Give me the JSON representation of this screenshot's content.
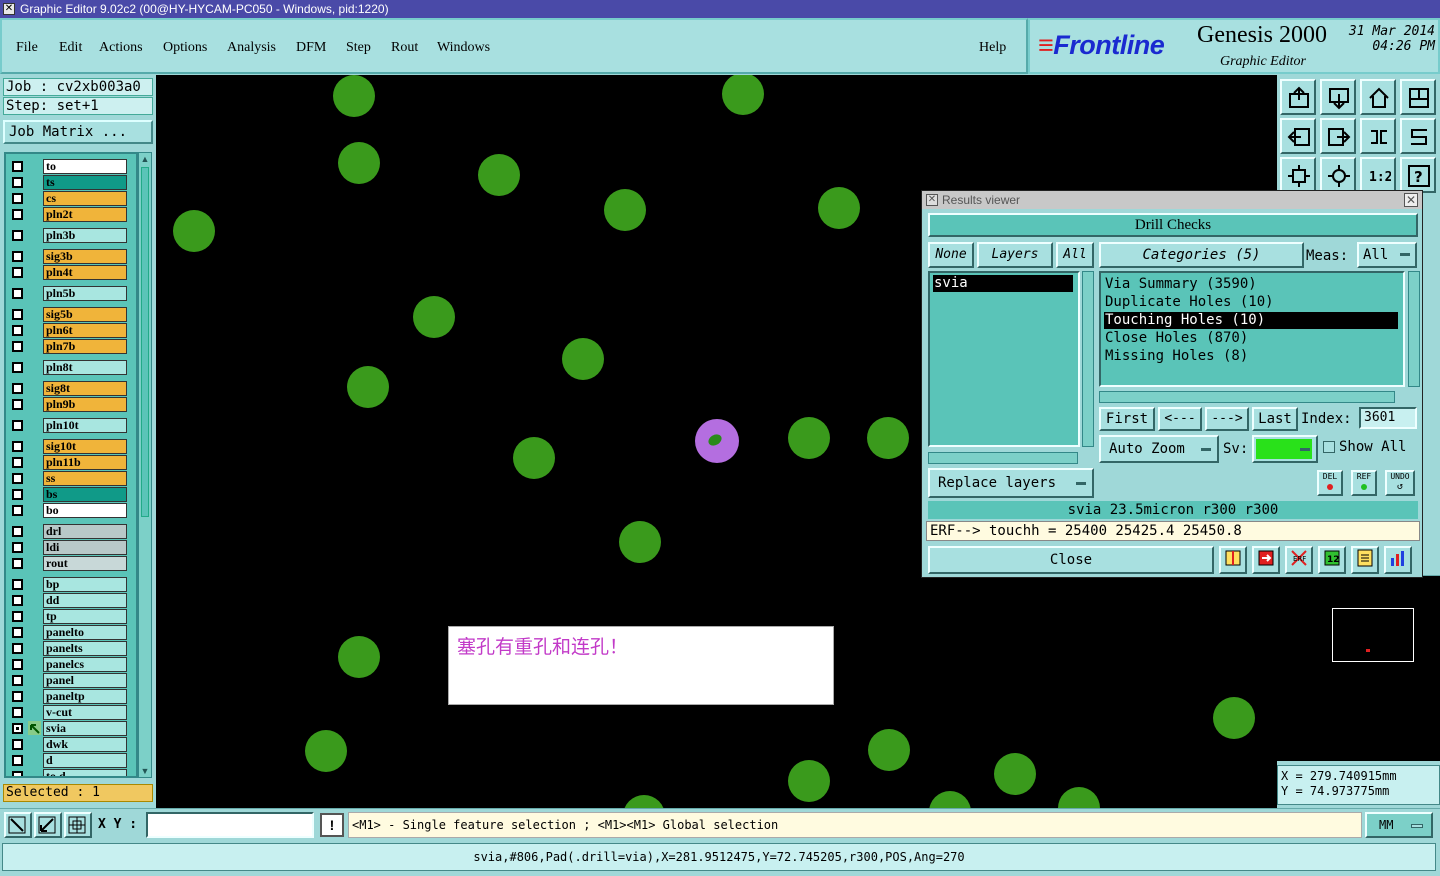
{
  "window": {
    "title": "Graphic Editor 9.02c2 (00@HY-HYCAM-PC050 - Windows, pid:1220)"
  },
  "menu": {
    "items": [
      "File",
      "Edit",
      "Actions",
      "Options",
      "Analysis",
      "DFM",
      "Step",
      "Rout",
      "Windows"
    ],
    "help": "Help"
  },
  "brand": {
    "logo": "Frontline",
    "product": "Genesis 2000",
    "subtitle": "Graphic Editor",
    "date": "31 Mar 2014",
    "time": "04:26 PM"
  },
  "job": {
    "job_line": "Job : cv2xb003a0",
    "step_line": "Step: set+1",
    "matrix_button": "Job Matrix ..."
  },
  "layers": [
    {
      "name": "to",
      "color": "white"
    },
    {
      "name": "ts",
      "color": "teal"
    },
    {
      "name": "cs",
      "color": "orange"
    },
    {
      "name": "pln2t",
      "color": "orange"
    },
    {
      "name": "pln3b",
      "color": "lt"
    },
    {
      "name": "sig3b",
      "color": "orange"
    },
    {
      "name": "pln4t",
      "color": "orange"
    },
    {
      "name": "pln5b",
      "color": "lt"
    },
    {
      "name": "sig5b",
      "color": "orange"
    },
    {
      "name": "pln6t",
      "color": "orange"
    },
    {
      "name": "pln7b",
      "color": "orange"
    },
    {
      "name": "pln8t",
      "color": "lt"
    },
    {
      "name": "sig8t",
      "color": "orange"
    },
    {
      "name": "pln9b",
      "color": "orange"
    },
    {
      "name": "pln10t",
      "color": "lt"
    },
    {
      "name": "sig10t",
      "color": "orange"
    },
    {
      "name": "pln11b",
      "color": "orange"
    },
    {
      "name": "ss",
      "color": "orange"
    },
    {
      "name": "bs",
      "color": "teal"
    },
    {
      "name": "bo",
      "color": "white"
    },
    {
      "name": "drl",
      "color": "grey"
    },
    {
      "name": "ldi",
      "color": "grey"
    },
    {
      "name": "rout",
      "color": "grey2"
    },
    {
      "name": "bp",
      "color": "lt"
    },
    {
      "name": "dd",
      "color": "lt"
    },
    {
      "name": "tp",
      "color": "lt"
    },
    {
      "name": "panelto",
      "color": "lt"
    },
    {
      "name": "panelts",
      "color": "lt"
    },
    {
      "name": "panelcs",
      "color": "lt"
    },
    {
      "name": "panel",
      "color": "lt"
    },
    {
      "name": "paneltp",
      "color": "lt"
    },
    {
      "name": "v-cut",
      "color": "lt"
    },
    {
      "name": "svia",
      "color": "lt"
    },
    {
      "name": "dwk",
      "color": "lt"
    },
    {
      "name": "d",
      "color": "lt"
    },
    {
      "name": "to.d",
      "color": "lt"
    }
  ],
  "selected": "Selected : 1",
  "note": "塞孔有重孔和连孔！",
  "results_viewer": {
    "title": "Results viewer",
    "header": "Drill Checks",
    "none_btn": "None",
    "layers_btn": "Layers",
    "all_btn": "All",
    "layer_items": [
      "svia"
    ],
    "categories_btn": "Categories (5)",
    "meas_label": "Meas:",
    "meas_value": "All",
    "categories": [
      "Via Summary (3590)",
      "Duplicate Holes (10)",
      "Touching Holes (10)",
      "Close Holes (870)",
      "Missing Holes (8)"
    ],
    "first_btn": "First",
    "prev_btn": "<---",
    "next_btn": "--->",
    "last_btn": "Last",
    "index_label": "Index:",
    "index_value": "3601",
    "autozoom_btn": "Auto Zoom",
    "sv_label": "Sv:",
    "showall_label": "Show All",
    "replace_btn": "Replace layers",
    "del_label": "DEL",
    "ref_label": "REF",
    "undo_label": "UNDO",
    "info_line": "svia 23.5micron  r300  r300",
    "erf_line": "ERF--> touchh = 25400 25425.4 25450.8",
    "close_btn": "Close",
    "colors": {
      "sv_green": "#29e11a"
    }
  },
  "coords": {
    "x": "X = 279.740915mm",
    "y": "Y = 74.973775mm"
  },
  "bottom": {
    "xy_label": "X Y :",
    "xy_value": "",
    "excl": "!",
    "hint": "<M1> - Single feature selection ; <M1><M1> Global selection",
    "units": "MM"
  },
  "status": "svia,#806,Pad(.drill=via),X=281.9512475,Y=72.745205,r300,POS,Ang=270"
}
